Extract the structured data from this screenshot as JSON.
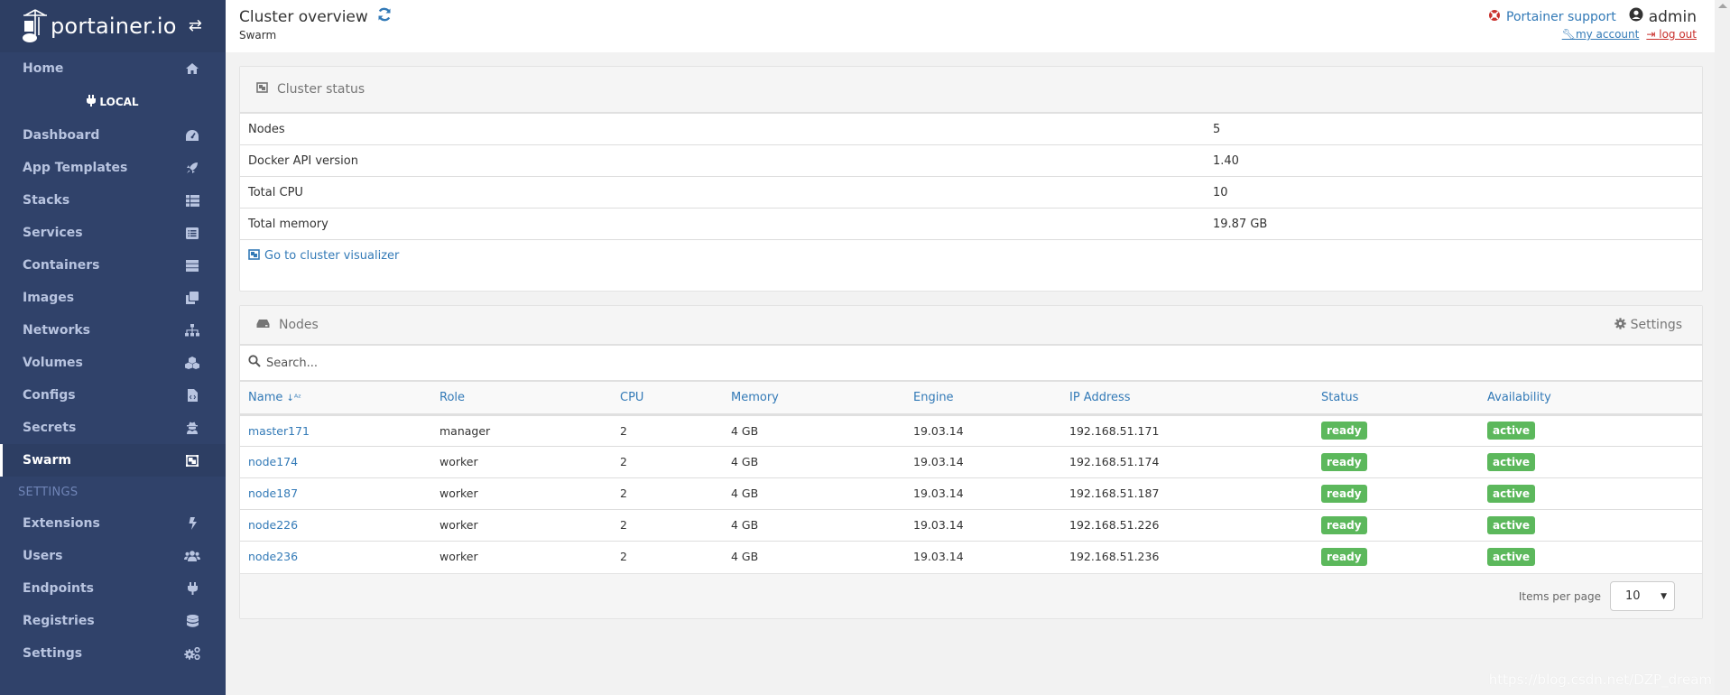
{
  "sidebar": {
    "brand": "portainer.io",
    "items_top": [
      {
        "label": "Home",
        "icon": "home-icon"
      }
    ],
    "endpoint": "LOCAL",
    "items": [
      {
        "label": "Dashboard",
        "icon": "tachometer-icon"
      },
      {
        "label": "App Templates",
        "icon": "rocket-icon"
      },
      {
        "label": "Stacks",
        "icon": "th-list-icon"
      },
      {
        "label": "Services",
        "icon": "list-alt-icon"
      },
      {
        "label": "Containers",
        "icon": "server-icon"
      },
      {
        "label": "Images",
        "icon": "clone-icon"
      },
      {
        "label": "Networks",
        "icon": "sitemap-icon"
      },
      {
        "label": "Volumes",
        "icon": "cubes-icon"
      },
      {
        "label": "Configs",
        "icon": "file-code-icon"
      },
      {
        "label": "Secrets",
        "icon": "user-secret-icon"
      },
      {
        "label": "Swarm",
        "icon": "object-group-icon",
        "active": true
      }
    ],
    "settings_title": "SETTINGS",
    "settings_items": [
      {
        "label": "Extensions",
        "icon": "bolt-icon"
      },
      {
        "label": "Users",
        "icon": "users-icon"
      },
      {
        "label": "Endpoints",
        "icon": "plug-icon"
      },
      {
        "label": "Registries",
        "icon": "database-icon"
      },
      {
        "label": "Settings",
        "icon": "cogs-icon"
      }
    ]
  },
  "header": {
    "title": "Cluster overview",
    "breadcrumb": "Swarm",
    "support": "Portainer support",
    "username": "admin",
    "my_account": "my account",
    "log_out": "log out"
  },
  "cluster_status": {
    "title": "Cluster status",
    "rows": [
      {
        "key": "Nodes",
        "value": "5"
      },
      {
        "key": "Docker API version",
        "value": "1.40"
      },
      {
        "key": "Total CPU",
        "value": "10"
      },
      {
        "key": "Total memory",
        "value": "19.87 GB"
      }
    ],
    "visualizer_link": "Go to cluster visualizer"
  },
  "nodes": {
    "title": "Nodes",
    "settings_label": "Settings",
    "search_placeholder": "Search...",
    "columns": [
      "Name",
      "Role",
      "CPU",
      "Memory",
      "Engine",
      "IP Address",
      "Status",
      "Availability"
    ],
    "rows": [
      {
        "name": "master171",
        "role": "manager",
        "cpu": "2",
        "memory": "4 GB",
        "engine": "19.03.14",
        "ip": "192.168.51.171",
        "status": "ready",
        "availability": "active"
      },
      {
        "name": "node174",
        "role": "worker",
        "cpu": "2",
        "memory": "4 GB",
        "engine": "19.03.14",
        "ip": "192.168.51.174",
        "status": "ready",
        "availability": "active"
      },
      {
        "name": "node187",
        "role": "worker",
        "cpu": "2",
        "memory": "4 GB",
        "engine": "19.03.14",
        "ip": "192.168.51.187",
        "status": "ready",
        "availability": "active"
      },
      {
        "name": "node226",
        "role": "worker",
        "cpu": "2",
        "memory": "4 GB",
        "engine": "19.03.14",
        "ip": "192.168.51.226",
        "status": "ready",
        "availability": "active"
      },
      {
        "name": "node236",
        "role": "worker",
        "cpu": "2",
        "memory": "4 GB",
        "engine": "19.03.14",
        "ip": "192.168.51.236",
        "status": "ready",
        "availability": "active"
      }
    ],
    "items_per_page_label": "Items per page",
    "items_per_page_value": "10"
  },
  "colors": {
    "sidebar_bg": "#30426a",
    "brand_bg": "#2d3e63",
    "link": "#337ab7",
    "success": "#5cb85c",
    "danger": "#c9302c"
  },
  "watermark": "https://blog.csdn.net/DZP_dream"
}
